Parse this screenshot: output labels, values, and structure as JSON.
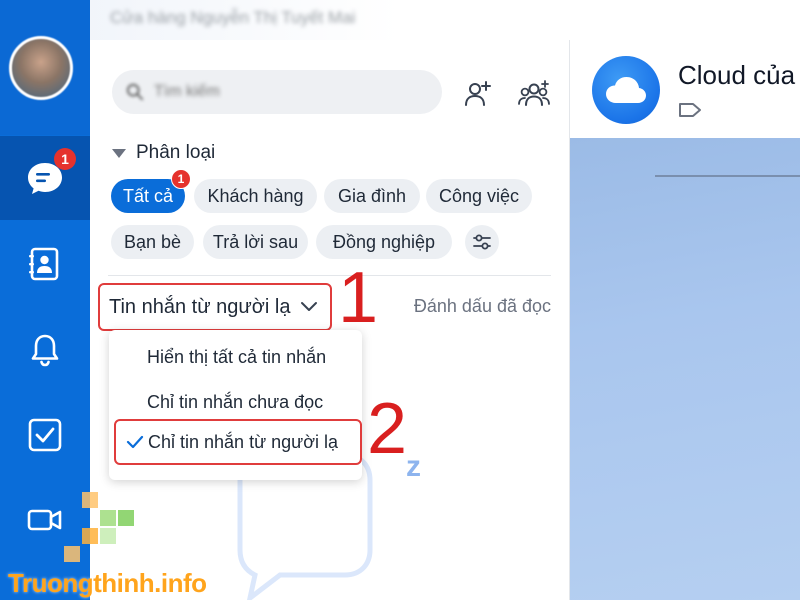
{
  "rail": {
    "items": [
      {
        "name": "messages",
        "icon": "chat-icon",
        "badge": "1",
        "active": true
      },
      {
        "name": "contacts",
        "icon": "contact-book-icon"
      },
      {
        "name": "notifications",
        "icon": "bell-icon"
      },
      {
        "name": "todo",
        "icon": "checkbox-icon"
      },
      {
        "name": "video",
        "icon": "video-camera-icon"
      }
    ]
  },
  "header": {
    "title": "Cửa hàng Nguyễn Thị Tuyết Mai"
  },
  "search": {
    "placeholder": "Tìm kiếm"
  },
  "category": {
    "heading": "Phân loại",
    "chips": [
      {
        "label": "Tất cả",
        "active": true,
        "badge": "1"
      },
      {
        "label": "Khách hàng"
      },
      {
        "label": "Gia đình"
      },
      {
        "label": "Công việc"
      },
      {
        "label": "Bạn bè"
      },
      {
        "label": "Trả lời sau"
      },
      {
        "label": "Đồng nghiệp"
      }
    ]
  },
  "filter": {
    "label": "Tin nhắn từ người lạ",
    "mark_read": "Đánh dấu đã đọc",
    "options": [
      {
        "label": "Hiển thị tất cả tin nhắn",
        "selected": false
      },
      {
        "label": "Chỉ tin nhắn chưa đọc",
        "selected": false
      },
      {
        "label": "Chỉ tin nhắn từ người lạ",
        "selected": true
      }
    ]
  },
  "annotations": {
    "step1": "1",
    "step2": "2"
  },
  "empty_state": {
    "sleep_letter": "z"
  },
  "chat": {
    "name": "Cloud của"
  },
  "watermark": {
    "brand": "Truongthinh",
    "suffix": ".info"
  },
  "colors": {
    "accent": "#0a6dd9",
    "highlight": "#e03c3c",
    "badge": "#e5322d",
    "watermark": "#ffa41c"
  }
}
